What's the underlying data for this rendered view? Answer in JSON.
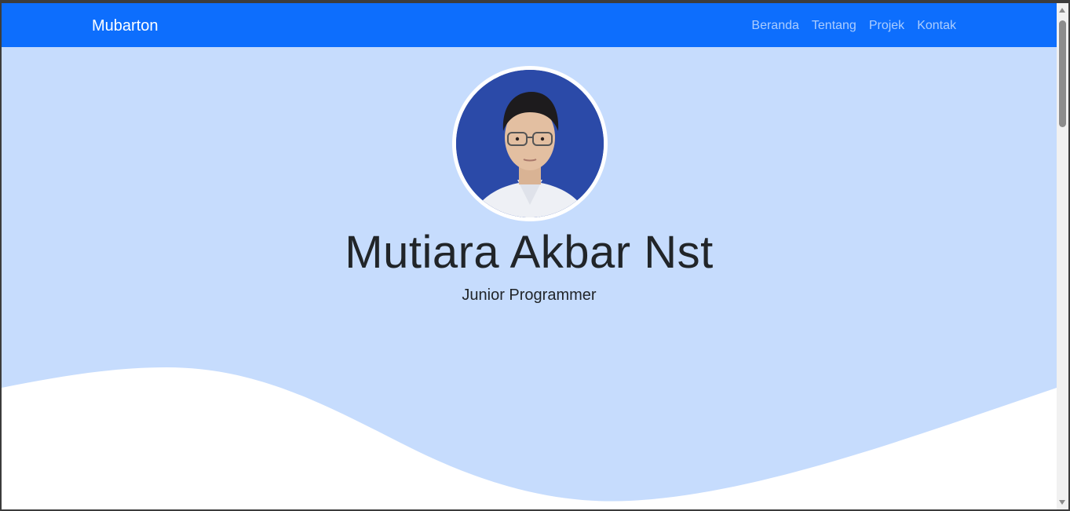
{
  "navbar": {
    "brand": "Mubarton",
    "links": [
      "Beranda",
      "Tentang",
      "Projek",
      "Kontak"
    ]
  },
  "hero": {
    "name": "Mutiara Akbar Nst",
    "role": "Junior Programmer"
  },
  "colors": {
    "navbar_bg": "#0d6efd",
    "hero_bg": "#c6dcfd",
    "wave_fill": "#ffffff"
  }
}
